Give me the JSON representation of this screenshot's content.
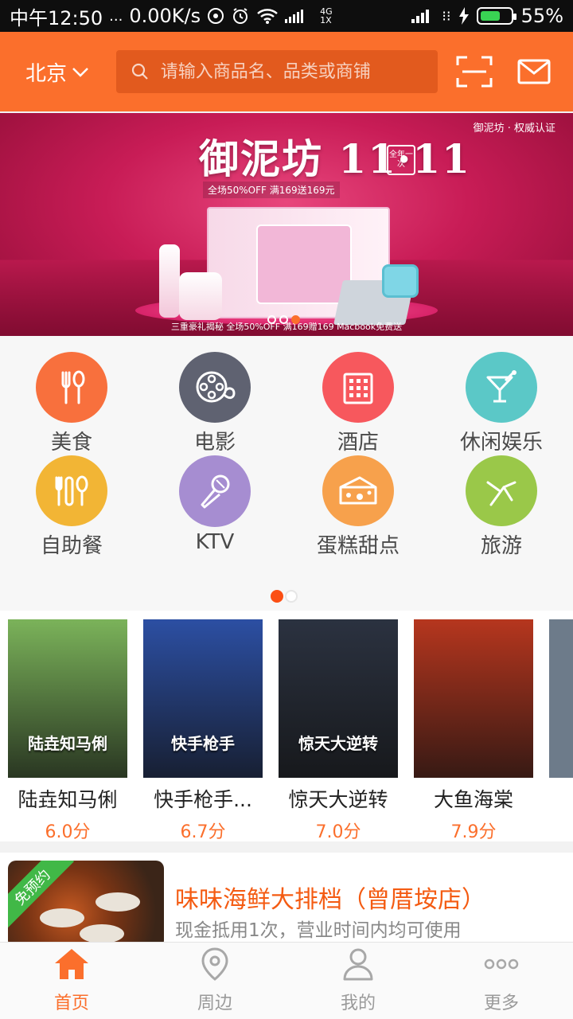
{
  "status_bar": {
    "time": "中午12:50",
    "dots": "...",
    "speed": "0.00K/s",
    "network": "4G\n1X",
    "battery": "55%"
  },
  "header": {
    "city": "北京",
    "search_placeholder": "请输入商品名、品类或商铺"
  },
  "banner": {
    "title": "御泥坊 11·11",
    "badge": "全年一次",
    "promo": "全场50%OFF  满169送169元",
    "brand": "御泥坊 · 权威认证",
    "bottom_text": "三重豪礼揭秘  全场50%OFF  满169赠169  Macbook免费送",
    "active_slide": 3,
    "total_slides": 3
  },
  "categories": [
    {
      "label": "美食",
      "color": "#f8703d",
      "icon": "fork-spoon-icon"
    },
    {
      "label": "电影",
      "color": "#5f6271",
      "icon": "film-reel-icon"
    },
    {
      "label": "酒店",
      "color": "#f7585d",
      "icon": "building-icon"
    },
    {
      "label": "休闲娱乐",
      "color": "#5bc8c7",
      "icon": "cocktail-icon"
    },
    {
      "label": "自助餐",
      "color": "#f2b535",
      "icon": "buffet-utensils-icon"
    },
    {
      "label": "KTV",
      "color": "#a68dd1",
      "icon": "microphone-icon"
    },
    {
      "label": "蛋糕甜点",
      "color": "#f7a14c",
      "icon": "cheese-cake-icon"
    },
    {
      "label": "旅游",
      "color": "#9ac849",
      "icon": "travel-icon"
    }
  ],
  "category_pages": {
    "active": 1,
    "total": 2
  },
  "movies": [
    {
      "name": "陆垚知马俐",
      "score": "6.0分",
      "poster_text": "陆垚知马俐",
      "bg": "#7bb35a"
    },
    {
      "name": "快手枪手...",
      "score": "6.7分",
      "poster_text": "快手枪手",
      "bg": "#2c4fa3"
    },
    {
      "name": "惊天大逆转",
      "score": "7.0分",
      "poster_text": "惊天大逆转",
      "bg": "#2b3240"
    },
    {
      "name": "大鱼海棠",
      "score": "7.9分",
      "poster_text": "",
      "bg": "#b6361e"
    }
  ],
  "deal": {
    "ribbon": "免预约",
    "title": "味味海鲜大排档（曾厝垵店）",
    "desc": "现金抵用1次，营业时间内均可使用"
  },
  "nav": [
    {
      "label": "首页",
      "icon": "home-icon",
      "active": true
    },
    {
      "label": "周边",
      "icon": "location-pin-icon",
      "active": false
    },
    {
      "label": "我的",
      "icon": "person-icon",
      "active": false
    },
    {
      "label": "更多",
      "icon": "more-dots-icon",
      "active": false
    }
  ],
  "colors": {
    "accent": "#fb6f2c",
    "search_bg": "#e25a1e",
    "score": "#fb6f2c",
    "deal_title": "#f45b12"
  }
}
